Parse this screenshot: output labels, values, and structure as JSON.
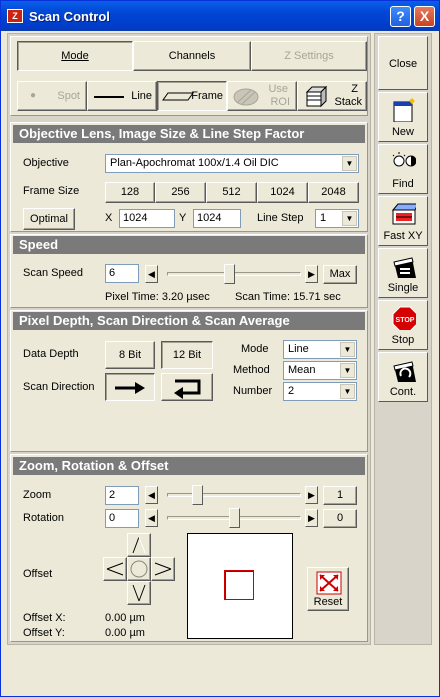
{
  "window": {
    "title": "Scan Control",
    "help": "?",
    "close": "X"
  },
  "tabs": [
    {
      "label": "Mode"
    },
    {
      "label": "Channels"
    },
    {
      "label": "Z Settings"
    }
  ],
  "scan_modes": {
    "spot": "Spot",
    "line": "Line",
    "frame": "Frame",
    "use_roi_1": "Use",
    "use_roi_2": "ROI",
    "zstack_1": "Z",
    "zstack_2": "Stack"
  },
  "objective_section": {
    "title": "Objective Lens, Image Size & Line Step Factor",
    "objective_label": "Objective",
    "objective_value": "Plan-Apochromat 100x/1.4 Oil DIC",
    "frame_size_label": "Frame Size",
    "frame_sizes": [
      "128",
      "256",
      "512",
      "1024",
      "2048"
    ],
    "optimal": "Optimal",
    "x_label": "X",
    "x_value": "1024",
    "y_label": "Y",
    "y_value": "1024",
    "line_step_label": "Line Step",
    "line_step_value": "1"
  },
  "speed_section": {
    "title": "Speed",
    "scan_speed_label": "Scan Speed",
    "scan_speed_value": "6",
    "scan_speed_fraction": 0.46,
    "max": "Max",
    "pixel_time": "Pixel Time:  3.20 µsec",
    "scan_time": "Scan Time:  15.71 sec"
  },
  "pixel_section": {
    "title": "Pixel Depth, Scan Direction & Scan Average",
    "data_depth_label": "Data Depth",
    "bit8": "8 Bit",
    "bit12": "12 Bit",
    "scan_direction_label": "Scan Direction",
    "mode_label": "Mode",
    "mode_value": "Line",
    "method_label": "Method",
    "method_value": "Mean",
    "number_label": "Number",
    "number_value": "2"
  },
  "zoom_section": {
    "title": "Zoom, Rotation & Offset",
    "zoom_label": "Zoom",
    "zoom_value": "2",
    "zoom_fraction": 0.2,
    "zoom_reset": "1",
    "rotation_label": "Rotation",
    "rotation_value": "0",
    "rotation_fraction": 0.5,
    "rotation_reset": "0",
    "offset_label": "Offset",
    "reset": "Reset",
    "offset_x_label": "Offset X:",
    "offset_x_value": "0.00 µm",
    "offset_y_label": "Offset Y:",
    "offset_y_value": "0.00 µm"
  },
  "right_toolbar": {
    "close": "Close",
    "new": "New",
    "find": "Find",
    "fast_xy": "Fast XY",
    "single": "Single",
    "stop": "Stop",
    "stop_sign": "STOP",
    "cont": "Cont."
  },
  "colors": {
    "title_bar": "#0054e3",
    "section_header": "#7a7a7a",
    "scan_area_box": "#cc0000",
    "scan_area_inner": "#2020cc"
  }
}
